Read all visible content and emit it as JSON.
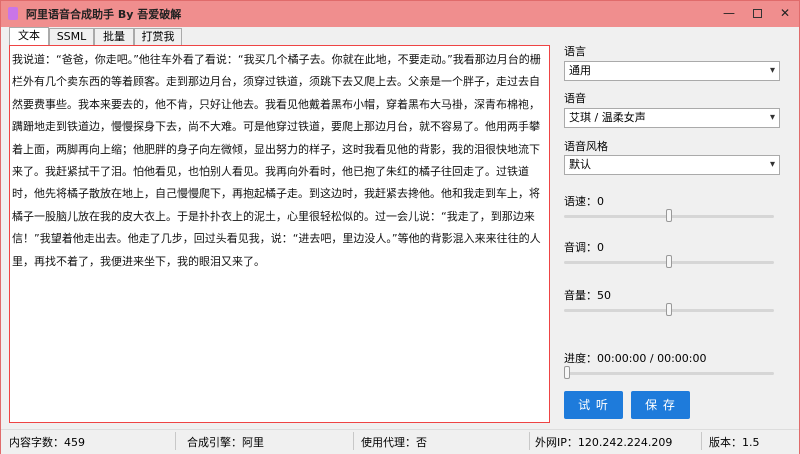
{
  "window": {
    "title": "阿里语音合成助手 By 吾爱破解",
    "min_glyph": "—",
    "close_glyph": "✕"
  },
  "tabs": [
    {
      "label": "文本"
    },
    {
      "label": "SSML"
    },
    {
      "label": "批量"
    },
    {
      "label": "打赏我"
    }
  ],
  "editor": {
    "text": "我说道：“爸爸，你走吧。”他往车外看了看说：“我买几个橘子去。你就在此地，不要走动。”我看那边月台的栅栏外有几个卖东西的等着顾客。走到那边月台，须穿过铁道，须跳下去又爬上去。父亲是一个胖子，走过去自然要费事些。我本来要去的，他不肯，只好让他去。我看见他戴着黑布小帽，穿着黑布大马褂，深青布棉袍，蹒跚地走到铁道边，慢慢探身下去，尚不大难。可是他穿过铁道，要爬上那边月台，就不容易了。他用两手攀着上面，两脚再向上缩；他肥胖的身子向左微倾，显出努力的样子，这时我看见他的背影，我的泪很快地流下来了。我赶紧拭干了泪。怕他看见，也怕别人看见。我再向外看时，他已抱了朱红的橘子往回走了。过铁道时，他先将橘子散放在地上，自己慢慢爬下，再抱起橘子走。到这边时，我赶紧去搀他。他和我走到车上，将橘子一股脑儿放在我的皮大衣上。于是扑扑衣上的泥土，心里很轻松似的。过一会儿说：“我走了，到那边来信！”我望着他走出去。他走了几步，回过头看见我，说：“进去吧，里边没人。”等他的背影混入来来往往的人里，再找不着了，我便进来坐下，我的眼泪又来了。"
  },
  "settings": {
    "language_label": "语言",
    "language_value": "通用",
    "voice_label": "语音",
    "voice_value": "艾琪 / 温柔女声",
    "style_label": "语音风格",
    "style_value": "默认",
    "speed_label": "语速：0",
    "speed_value": 0,
    "pitch_label": "音调：0",
    "pitch_value": 0,
    "volume_label": "音量：50",
    "volume_value": 50,
    "progress_label": "进度：00:00:00 / 00:00:00",
    "progress_fraction": 0
  },
  "buttons": {
    "listen": "试 听",
    "save": "保 存"
  },
  "statusbar": {
    "char_count": "内容字数：459",
    "engine": "合成引擎：阿里",
    "proxy": "使用代理：否",
    "ip": "外网IP：120.242.224.209",
    "version": "版本：1.5"
  },
  "colors": {
    "titlebar": "#f08e8e",
    "accent_button": "#1e7bdb",
    "panel_border": "#ee4444",
    "icon": "#c975e8"
  },
  "icons": [
    "app-icon",
    "minimize-icon",
    "maximize-icon",
    "close-icon",
    "chevron-down-icon"
  ]
}
